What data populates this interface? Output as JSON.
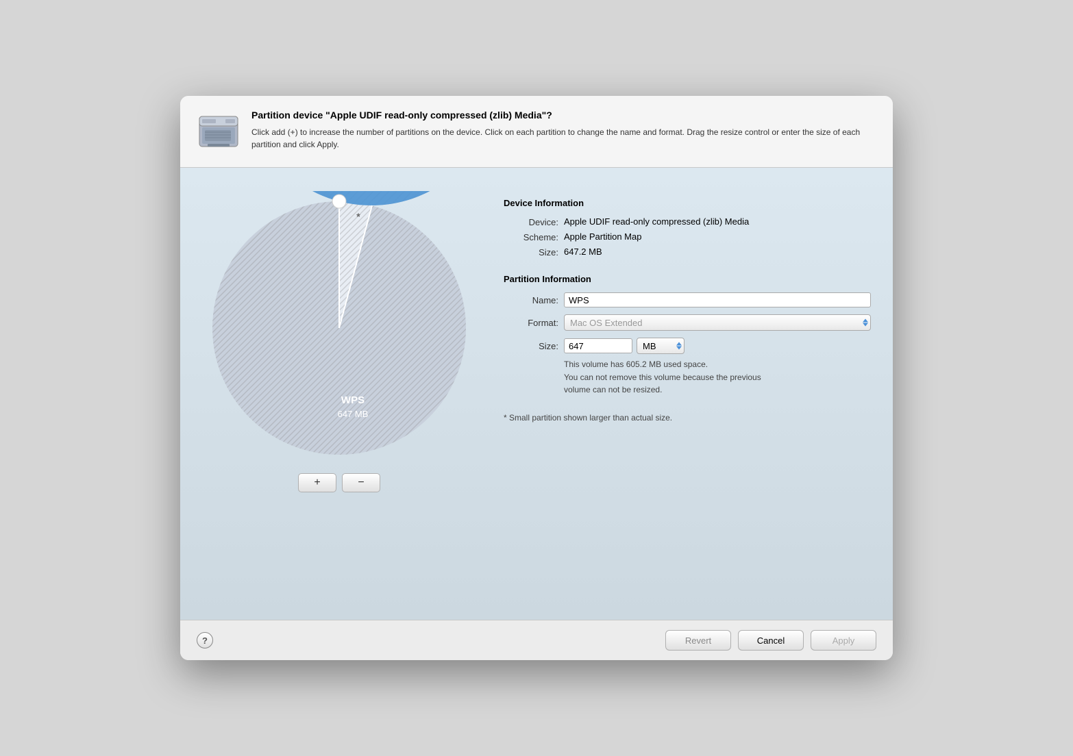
{
  "dialog": {
    "title": "Partition device \"Apple UDIF read-only compressed (zlib) Media\"?",
    "description": "Click add (+) to increase the number of partitions on the device. Click on each partition to change the name and format. Drag the resize control or enter the size of each partition and click Apply."
  },
  "device_info": {
    "section_title": "Device Information",
    "device_label": "Device:",
    "device_value": "Apple UDIF read-only compressed (zlib) Media",
    "scheme_label": "Scheme:",
    "scheme_value": "Apple Partition Map",
    "size_label": "Size:",
    "size_value": "647.2 MB"
  },
  "partition_info": {
    "section_title": "Partition Information",
    "name_label": "Name:",
    "name_value": "WPS",
    "format_label": "Format:",
    "format_placeholder": "Mac OS Extended",
    "size_label": "Size:",
    "size_value": "647",
    "size_unit": "MB",
    "notice": "This volume has 605.2 MB used space.\nYou can not remove this volume because the previous\nvolume can not be resized.",
    "footnote": "* Small partition shown larger than actual size."
  },
  "pie_chart": {
    "main_label": "WPS",
    "main_size": "647 MB",
    "main_color": "#5b9bd5",
    "small_color": "#d0d8e8",
    "asterisk": "*"
  },
  "controls": {
    "add_label": "+",
    "remove_label": "−"
  },
  "footer": {
    "help_label": "?",
    "revert_label": "Revert",
    "cancel_label": "Cancel",
    "apply_label": "Apply"
  }
}
